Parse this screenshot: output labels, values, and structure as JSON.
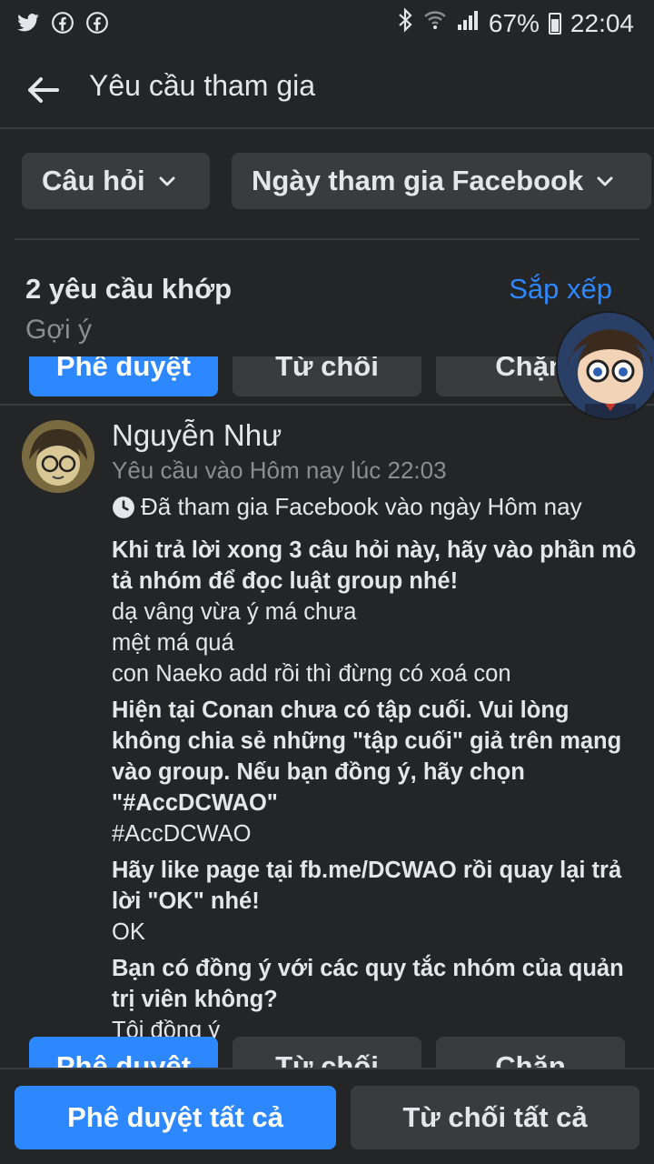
{
  "status_bar": {
    "left_icons": [
      "twitter-icon",
      "facebook-icon",
      "facebook-icon"
    ],
    "battery": "67%",
    "time": "22:04"
  },
  "header": {
    "title": "Yêu cầu tham gia"
  },
  "filters": {
    "chip1": "Câu hỏi",
    "chip2": "Ngày tham gia Facebook"
  },
  "summary": {
    "count": "2 yêu cầu khớp",
    "sort": "Sắp xếp",
    "suggest": "Gợi ý"
  },
  "row_actions": {
    "approve": "Phê duyệt",
    "decline": "Từ chối",
    "block": "Chặn"
  },
  "request": {
    "name": "Nguyễn Như",
    "meta": "Yêu cầu vào Hôm nay lúc 22:03",
    "joined": "Đã tham gia Facebook vào ngày Hôm nay",
    "qa": [
      {
        "q": "Khi trả lời xong 3 câu hỏi này, hãy vào phần mô tả nhóm để đọc luật group nhé!",
        "a": [
          "dạ vâng vừa ý má chưa",
          "mệt má quá",
          "con Naeko add rồi thì đừng có xoá con"
        ]
      },
      {
        "q": "Hiện tại Conan chưa có tập cuối. Vui lòng không chia sẻ những \"tập cuối\" giả trên mạng vào group. Nếu bạn đồng ý, hãy chọn \"#AccDCWAO\"",
        "a": [
          "#AccDCWAO"
        ]
      },
      {
        "q": "Hãy like page tại fb.me/DCWAO rồi quay lại trả lời \"OK\" nhé!",
        "a": [
          "OK"
        ]
      },
      {
        "q": "Bạn có đồng ý với các quy tắc nhóm của quản trị viên không?",
        "a": [
          "Tôi đồng ý"
        ]
      }
    ]
  },
  "bottom": {
    "approve_all": "Phê duyệt tất cả",
    "decline_all": "Từ chối tất cả"
  },
  "colors": {
    "background": "#242526",
    "surface": "#3a3b3c",
    "accent": "#2d88ff",
    "text": "#e4e6eb",
    "muted": "#8a8d91"
  }
}
